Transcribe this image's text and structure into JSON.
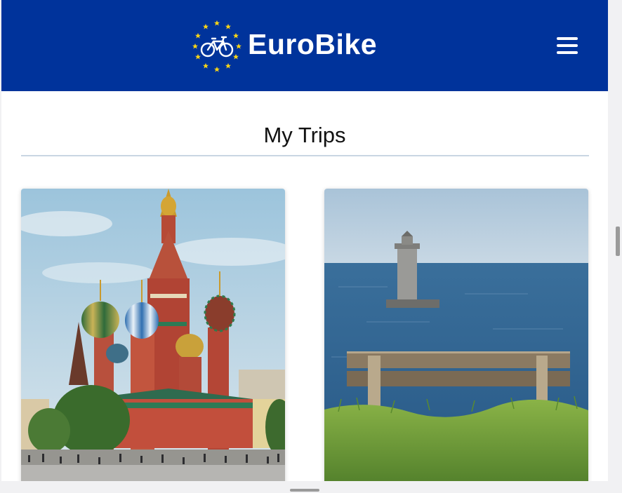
{
  "header": {
    "brand": "EuroBike",
    "colors": {
      "background": "#00339b",
      "stars": "#f7d417",
      "text": "#ffffff"
    },
    "menu_icon": "hamburger-menu-icon"
  },
  "main": {
    "title": "My Trips",
    "trips": [
      {
        "image": "st-basils-cathedral-moscow-photo"
      },
      {
        "image": "lighthouse-sea-bench-photo"
      }
    ]
  }
}
